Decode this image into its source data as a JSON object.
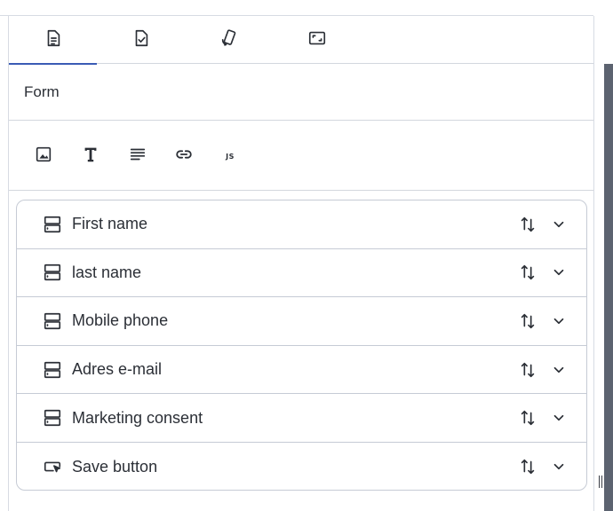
{
  "tabs": [
    {
      "name": "document",
      "icon": "document-icon",
      "active": true
    },
    {
      "name": "checklist",
      "icon": "document-check-icon",
      "active": false
    },
    {
      "name": "device-rotate",
      "icon": "device-rotate-icon",
      "active": false
    },
    {
      "name": "fullscreen",
      "icon": "fullscreen-icon",
      "active": false
    }
  ],
  "section": {
    "title": "Form"
  },
  "toolbar": {
    "tools": [
      {
        "icon": "image-icon"
      },
      {
        "icon": "text-icon"
      },
      {
        "icon": "paragraph-icon"
      },
      {
        "icon": "link-icon"
      },
      {
        "icon": "js-icon",
        "label": "JS"
      }
    ]
  },
  "fields": [
    {
      "label": "First name",
      "icon": "input-field-icon"
    },
    {
      "label": "last name",
      "icon": "input-field-icon"
    },
    {
      "label": "Mobile phone",
      "icon": "input-field-icon"
    },
    {
      "label": "Adres e-mail",
      "icon": "input-field-icon"
    },
    {
      "label": "Marketing consent",
      "icon": "input-field-icon"
    },
    {
      "label": "Save button",
      "icon": "button-icon"
    }
  ],
  "colors": {
    "accent": "#3b5bb5",
    "border": "#c6cbd5",
    "text": "#2b2f36",
    "scrollbar": "#5c6370"
  }
}
